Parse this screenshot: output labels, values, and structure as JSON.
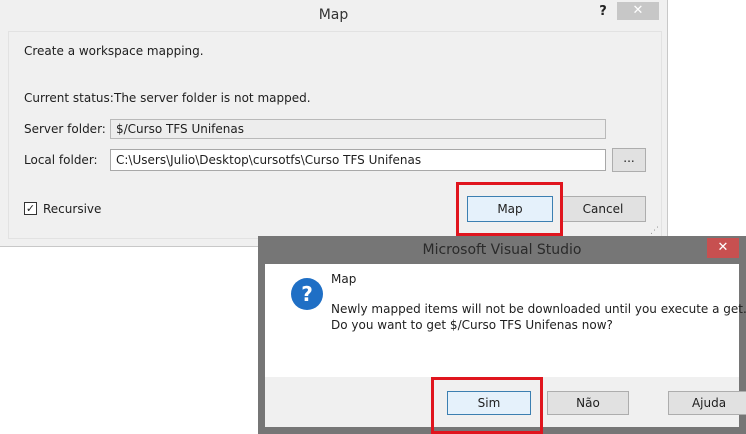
{
  "map_dialog": {
    "title": "Map",
    "help_label": "?",
    "close_label": "✕",
    "description": "Create a workspace mapping.",
    "current_status_label": "Current status:",
    "current_status_value": "The server folder is not mapped.",
    "server_folder_label": "Server folder:",
    "server_folder_value": "$/Curso TFS Unifenas",
    "local_folder_label": "Local folder:",
    "local_folder_value": "C:\\Users\\Julio\\Desktop\\cursotfs\\Curso TFS Unifenas",
    "browse_label": "...",
    "recursive_label": "Recursive",
    "recursive_checked": true,
    "map_button": "Map",
    "cancel_button": "Cancel"
  },
  "message_box": {
    "title": "Microsoft Visual Studio",
    "close_label": "✕",
    "icon": "question-icon",
    "heading": "Map",
    "line1": "Newly mapped items will not be downloaded until you execute a get.",
    "line2": "Do you want to get $/Curso TFS Unifenas now?",
    "yes_button": "Sim",
    "no_button": "Não",
    "help_button": "Ajuda"
  },
  "colors": {
    "highlight": "#e0151e",
    "accent": "#1f6fc5",
    "close_red": "#c75050"
  }
}
